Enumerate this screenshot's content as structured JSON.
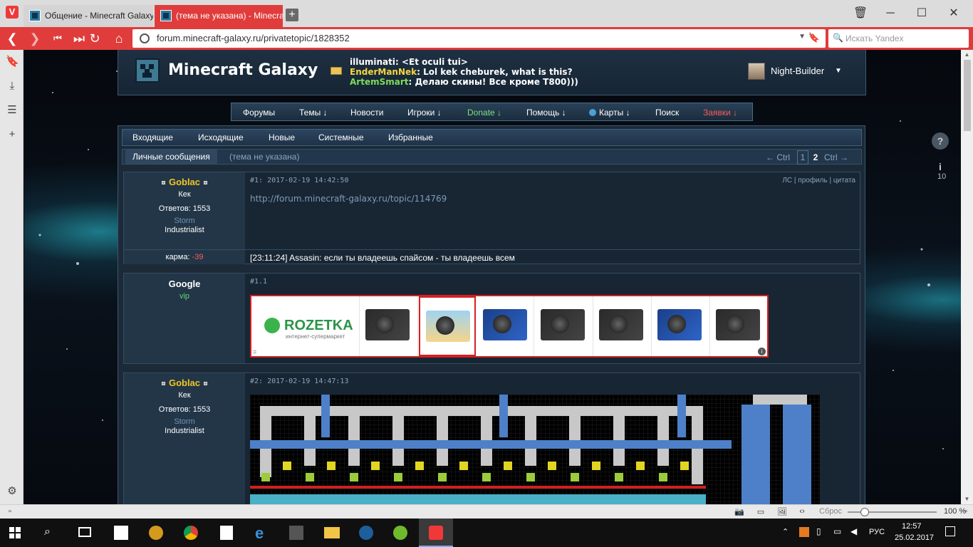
{
  "browser": {
    "tabs": [
      {
        "label": "Общение - Minecraft Galaxy"
      },
      {
        "label": "(тема не указана) - Minecraft Galaxy"
      }
    ],
    "url": "forum.minecraft-galaxy.ru/privatetopic/1828352",
    "search_placeholder": "Искать Yandex",
    "zoom_reset_label": "Сброс",
    "zoom_level": "100 %",
    "accent_color": "#e03c3c"
  },
  "forum": {
    "site_title": "Minecraft Galaxy",
    "shoutbox": [
      {
        "nick": "illuminati",
        "text": ": <Et oculi tui>"
      },
      {
        "nick": "EnderManNek",
        "text": ": Lol kek cheburek, what is this?"
      },
      {
        "nick": "ArtemSmart",
        "text": ": Делаю скины! Все кроме Т800)))"
      }
    ],
    "user": {
      "name": "Night-Builder"
    },
    "nav": [
      {
        "label": "Форумы"
      },
      {
        "label": "Темы ↓"
      },
      {
        "label": "Новости"
      },
      {
        "label": "Игроки ↓"
      },
      {
        "label": "Donate ↓"
      },
      {
        "label": "Помощь ↓"
      },
      {
        "label": "Карты ↓"
      },
      {
        "label": "Поиск"
      },
      {
        "label": "Заявки ↓"
      }
    ],
    "pm_tabs": [
      {
        "label": "Входящие"
      },
      {
        "label": "Исходящие"
      },
      {
        "label": "Новые"
      },
      {
        "label": "Системные"
      },
      {
        "label": "Избранные"
      }
    ],
    "breadcrumb": {
      "section": "Личные сообщения",
      "topic": "(тема не указана)"
    },
    "pager": {
      "prev": "← Ctrl",
      "page1": "1",
      "page2": "2",
      "next": "Ctrl →"
    },
    "posts": [
      {
        "author": "Goblac",
        "title": "Кек",
        "replies": "Ответов: 1553",
        "group": "Storm",
        "rank": "Industrialist",
        "meta": "#1: 2017-02-19 14:42:50",
        "actions": "ЛС | профиль | цитата",
        "link": "http://forum.minecraft-galaxy.ru/topic/114769",
        "karma_label": "карма:",
        "karma_value": "-39",
        "signature": "[23:11:24] Assasin: если ты владеешь спайсом - ты владеешь всем"
      },
      {
        "author": "Google",
        "group": "vip",
        "meta": "#1.1",
        "ad_brand": "ROZETKA",
        "ad_sub": "интернет-супермаркет"
      },
      {
        "author": "Goblac",
        "title": "Кек",
        "replies": "Ответов: 1553",
        "group": "Storm",
        "rank": "Industrialist",
        "meta": "#2: 2017-02-19 14:47:13"
      }
    ]
  },
  "taskbar": {
    "language": "РУС",
    "time": "12:57",
    "date": "25.02.2017"
  },
  "side_badge": "10"
}
